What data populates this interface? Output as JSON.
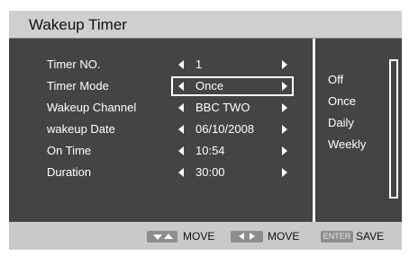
{
  "window": {
    "title": "Wakeup Timer"
  },
  "rows": [
    {
      "label": "Timer NO.",
      "value": "1"
    },
    {
      "label": "Timer Mode",
      "value": "Once"
    },
    {
      "label": "Wakeup Channel",
      "value": "BBC TWO"
    },
    {
      "label": "wakeup Date",
      "value": "06/10/2008"
    },
    {
      "label": "On Time",
      "value": "10:54"
    },
    {
      "label": "Duration",
      "value": "30:00"
    }
  ],
  "selected_row": "Timer Mode",
  "options": [
    "Off",
    "Once",
    "Daily",
    "Weekly"
  ],
  "footer": {
    "move_vertical_label": "MOVE",
    "move_horizontal_label": "MOVE",
    "enter_key_label": "ENTER",
    "save_label": "SAVE"
  },
  "icons": {
    "row_left": "triangle-left-icon",
    "row_right": "triangle-right-icon",
    "footer_updown": "up-down-arrows-icon",
    "footer_leftright": "left-right-arrows-icon"
  },
  "colors": {
    "panel": "#444444",
    "title_bar": "#cfcfcf",
    "footer_bar": "#c9c9c9",
    "text": "#ffffff"
  }
}
